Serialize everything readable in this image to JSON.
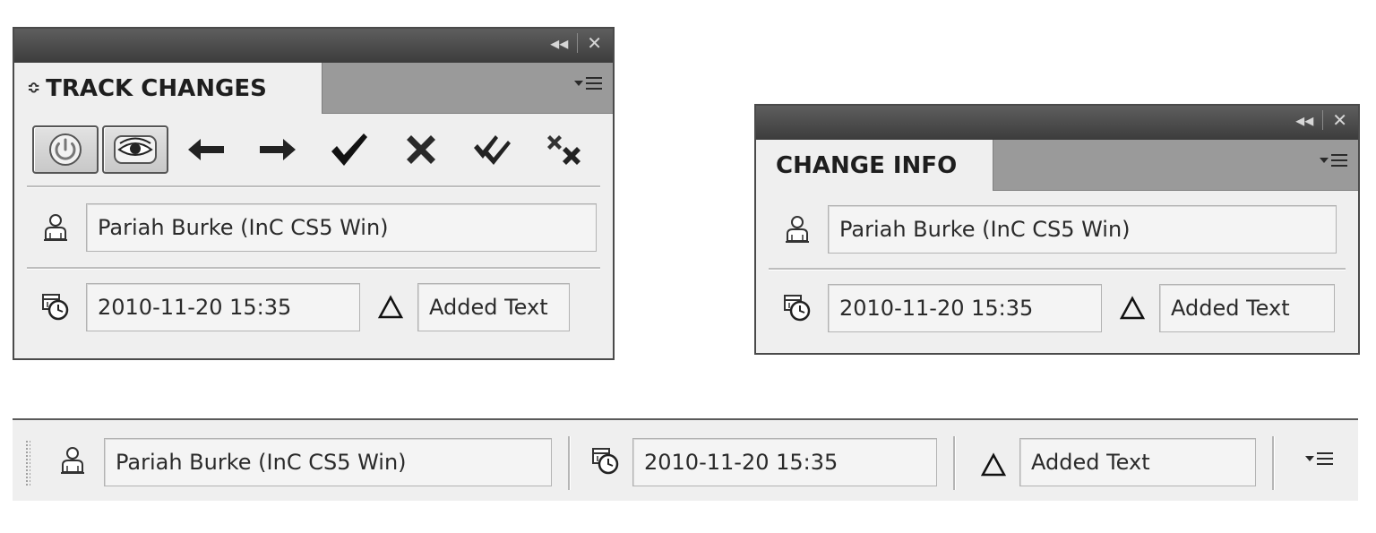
{
  "track_changes_panel": {
    "tab_label": "TRACK CHANGES",
    "tab_arrows": "≎",
    "user": "Pariah Burke (InC CS5 Win)",
    "datetime": "2010-11-20 15:35",
    "change_type": "Added Text"
  },
  "change_info_panel": {
    "tab_label": "CHANGE INFO",
    "user": "Pariah Burke (InC CS5 Win)",
    "datetime": "2010-11-20 15:35",
    "change_type": "Added Text"
  },
  "control_bar": {
    "user": "Pariah Burke (InC CS5 Win)",
    "datetime": "2010-11-20 15:35",
    "change_type": "Added Text"
  },
  "titlebar": {
    "collapse_glyph": "◂◂",
    "close_glyph": "✕"
  },
  "icons": {
    "toggle_tracking": "power-icon",
    "show_hide": "eye-icon",
    "previous": "arrow-left-icon",
    "next": "arrow-right-icon",
    "accept": "check-icon",
    "reject": "x-icon",
    "accept_all": "double-check-icon",
    "reject_all": "double-x-icon",
    "user": "user-icon",
    "date": "clock-calendar-icon",
    "type": "delta-icon",
    "panel_menu": "panel-menu-icon"
  }
}
